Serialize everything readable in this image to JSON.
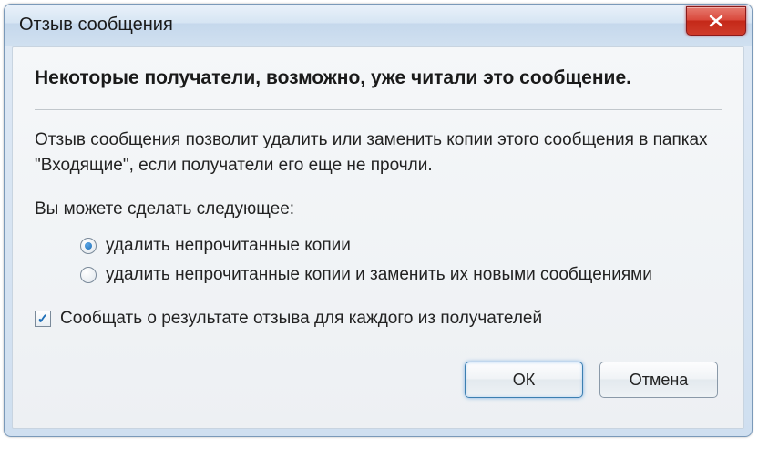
{
  "window": {
    "title": "Отзыв сообщения"
  },
  "content": {
    "heading": "Некоторые получатели, возможно, уже читали это сообщение.",
    "description": "Отзыв сообщения позволит удалить или заменить  копии этого сообщения в папках \"Входящие\", если получатели его еще не прочли.",
    "prompt": "Вы можете сделать следующее:",
    "radio_options": [
      {
        "label": "удалить непрочитанные копии",
        "checked": true
      },
      {
        "label": "удалить непрочитанные копии и заменить их новыми сообщениями",
        "checked": false
      }
    ],
    "checkbox": {
      "label": "Сообщать о результате отзыва для каждого из получателей",
      "checked": true
    }
  },
  "buttons": {
    "ok": "ОК",
    "cancel": "Отмена"
  }
}
